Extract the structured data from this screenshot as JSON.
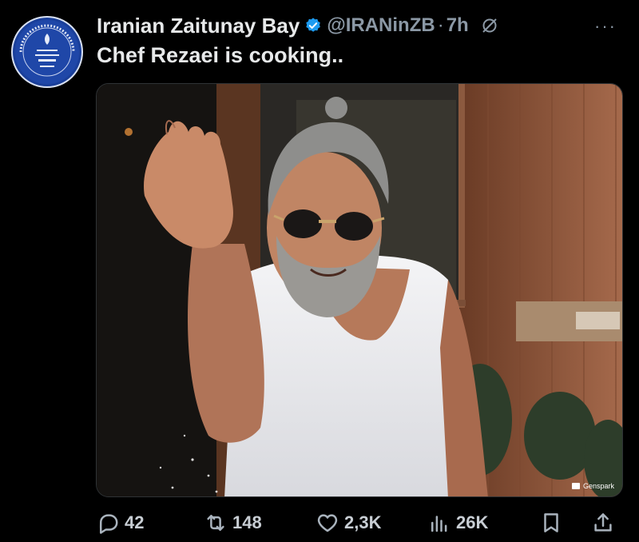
{
  "author": {
    "display_name": "Iranian Zaitunay Bay",
    "handle": "@IRANinZB",
    "separator": "·",
    "time": "7h",
    "more_label": "···",
    "verified_color": "#1d9bf0",
    "avatar_colors": {
      "bg": "#1a3f9a",
      "ring": "#d9e1f2"
    }
  },
  "tweet": {
    "text": "Chef Rezaei is cooking.."
  },
  "media": {
    "watermark": "Genspark"
  },
  "actions": {
    "replies": "42",
    "retweets": "148",
    "likes": "2,3K",
    "views": "26K"
  }
}
